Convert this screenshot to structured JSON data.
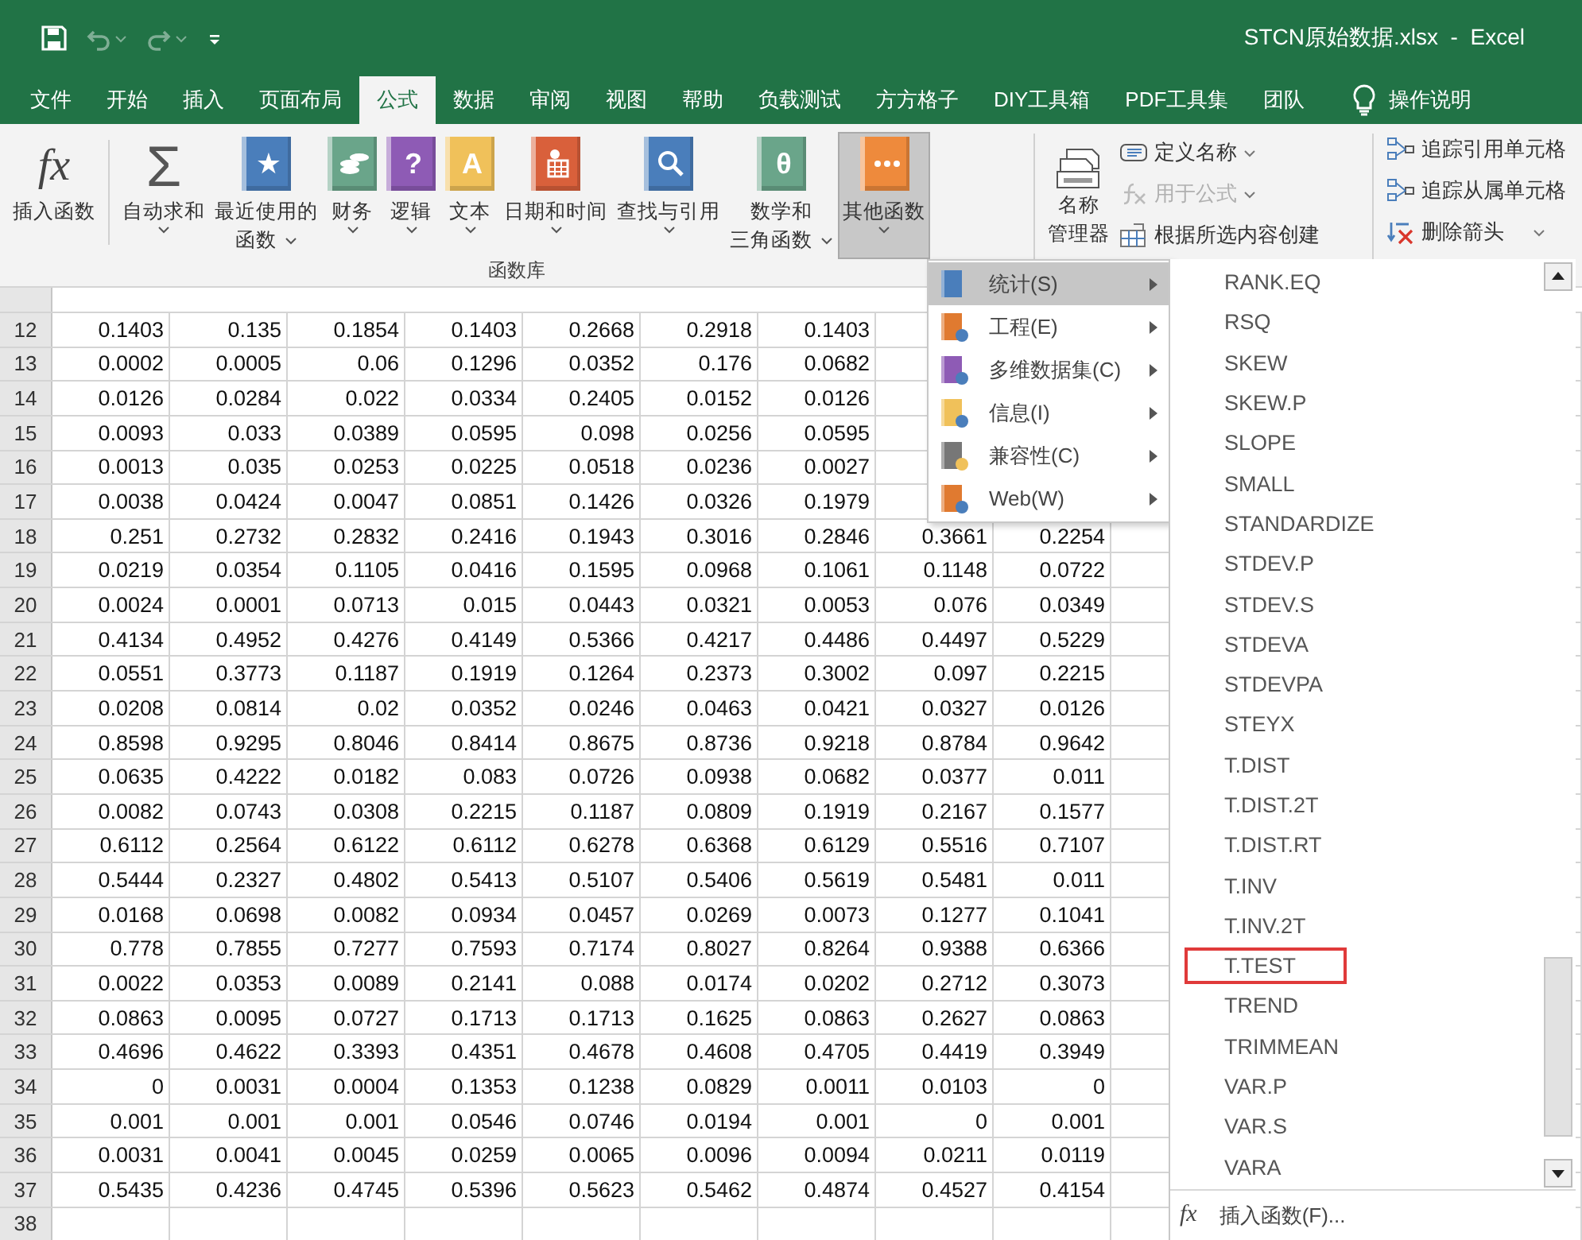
{
  "window": {
    "title": "STCN原始数据.xlsx  -  Excel"
  },
  "tabs": [
    {
      "label": "文件",
      "selected": false
    },
    {
      "label": "开始",
      "selected": false
    },
    {
      "label": "插入",
      "selected": false
    },
    {
      "label": "页面布局",
      "selected": false
    },
    {
      "label": "公式",
      "selected": true
    },
    {
      "label": "数据",
      "selected": false
    },
    {
      "label": "审阅",
      "selected": false
    },
    {
      "label": "视图",
      "selected": false
    },
    {
      "label": "帮助",
      "selected": false
    },
    {
      "label": "负载测试",
      "selected": false
    },
    {
      "label": "方方格子",
      "selected": false
    },
    {
      "label": "DIY工具箱",
      "selected": false
    },
    {
      "label": "PDF工具集",
      "selected": false
    },
    {
      "label": "团队",
      "selected": false
    }
  ],
  "tell_me": {
    "label": "操作说明"
  },
  "function_library": {
    "label": "函数库",
    "buttons": [
      {
        "lines": [
          "插入函数"
        ],
        "glyph": "fx",
        "dropdown": false,
        "pressed": false
      },
      {
        "lines": [
          "自动求和"
        ],
        "glyph": "Σ",
        "dropdown": true,
        "pressed": false
      },
      {
        "lines": [
          "最近使用的",
          "函数"
        ],
        "glyph": "★",
        "dropdown": true,
        "pressed": false
      },
      {
        "lines": [
          "财务"
        ],
        "dropdown": true,
        "pressed": false
      },
      {
        "lines": [
          "逻辑"
        ],
        "glyph": "?",
        "dropdown": true,
        "pressed": false
      },
      {
        "lines": [
          "文本"
        ],
        "glyph": "A",
        "dropdown": true,
        "pressed": false
      },
      {
        "lines": [
          "日期和时间"
        ],
        "dropdown": true,
        "pressed": false
      },
      {
        "lines": [
          "查找与引用"
        ],
        "dropdown": true,
        "pressed": false
      },
      {
        "lines": [
          "数学和",
          "三角函数"
        ],
        "glyph": "θ",
        "dropdown": true,
        "pressed": false
      },
      {
        "lines": [
          "其他函数"
        ],
        "dropdown": true,
        "pressed": true
      }
    ]
  },
  "defined_names": {
    "manager": {
      "lines": [
        "名称",
        "管理器"
      ]
    },
    "commands": [
      {
        "label": "定义名称",
        "dropdown": true,
        "disabled": false
      },
      {
        "label": "用于公式",
        "dropdown": true,
        "disabled": true
      },
      {
        "label": "根据所选内容创建",
        "dropdown": false,
        "disabled": false
      }
    ]
  },
  "auditing": {
    "commands": [
      {
        "label": "追踪引用单元格",
        "dropdown": false
      },
      {
        "label": "追踪从属单元格",
        "dropdown": false
      },
      {
        "label": "删除箭头",
        "dropdown": true
      }
    ]
  },
  "sheet": {
    "rows": [
      {
        "header": "12",
        "cells": [
          "0.1403",
          "0.135",
          "0.1854",
          "0.1403",
          "0.2668",
          "0.2918",
          "0.1403"
        ]
      },
      {
        "header": "13",
        "cells": [
          "0.0002",
          "0.0005",
          "0.06",
          "0.1296",
          "0.0352",
          "0.176",
          "0.0682"
        ]
      },
      {
        "header": "14",
        "cells": [
          "0.0126",
          "0.0284",
          "0.022",
          "0.0334",
          "0.2405",
          "0.0152",
          "0.0126"
        ]
      },
      {
        "header": "15",
        "cells": [
          "0.0093",
          "0.033",
          "0.0389",
          "0.0595",
          "0.098",
          "0.0256",
          "0.0595"
        ]
      },
      {
        "header": "16",
        "cells": [
          "0.0013",
          "0.035",
          "0.0253",
          "0.0225",
          "0.0518",
          "0.0236",
          "0.0027"
        ]
      },
      {
        "header": "17",
        "cells": [
          "0.0038",
          "0.0424",
          "0.0047",
          "0.0851",
          "0.1426",
          "0.0326",
          "0.1979"
        ]
      },
      {
        "header": "18",
        "cells": [
          "0.251",
          "0.2732",
          "0.2832",
          "0.2416",
          "0.1943",
          "0.3016",
          "0.2846",
          "0.3661",
          "0.2254"
        ]
      },
      {
        "header": "19",
        "cells": [
          "0.0219",
          "0.0354",
          "0.1105",
          "0.0416",
          "0.1595",
          "0.0968",
          "0.1061",
          "0.1148",
          "0.0722"
        ]
      },
      {
        "header": "20",
        "cells": [
          "0.0024",
          "0.0001",
          "0.0713",
          "0.015",
          "0.0443",
          "0.0321",
          "0.0053",
          "0.076",
          "0.0349"
        ]
      },
      {
        "header": "21",
        "cells": [
          "0.4134",
          "0.4952",
          "0.4276",
          "0.4149",
          "0.5366",
          "0.4217",
          "0.4486",
          "0.4497",
          "0.5229"
        ]
      },
      {
        "header": "22",
        "cells": [
          "0.0551",
          "0.3773",
          "0.1187",
          "0.1919",
          "0.1264",
          "0.2373",
          "0.3002",
          "0.097",
          "0.2215"
        ]
      },
      {
        "header": "23",
        "cells": [
          "0.0208",
          "0.0814",
          "0.02",
          "0.0352",
          "0.0246",
          "0.0463",
          "0.0421",
          "0.0327",
          "0.0126"
        ]
      },
      {
        "header": "24",
        "cells": [
          "0.8598",
          "0.9295",
          "0.8046",
          "0.8414",
          "0.8675",
          "0.8736",
          "0.9218",
          "0.8784",
          "0.9642"
        ]
      },
      {
        "header": "25",
        "cells": [
          "0.0635",
          "0.4222",
          "0.0182",
          "0.083",
          "0.0726",
          "0.0938",
          "0.0682",
          "0.0377",
          "0.011"
        ]
      },
      {
        "header": "26",
        "cells": [
          "0.0082",
          "0.0743",
          "0.0308",
          "0.2215",
          "0.1187",
          "0.0809",
          "0.1919",
          "0.2167",
          "0.1577"
        ]
      },
      {
        "header": "27",
        "cells": [
          "0.6112",
          "0.2564",
          "0.6122",
          "0.6112",
          "0.6278",
          "0.6368",
          "0.6129",
          "0.5516",
          "0.7107"
        ]
      },
      {
        "header": "28",
        "cells": [
          "0.5444",
          "0.2327",
          "0.4802",
          "0.5413",
          "0.5107",
          "0.5406",
          "0.5619",
          "0.5481",
          "0.011"
        ]
      },
      {
        "header": "29",
        "cells": [
          "0.0168",
          "0.0698",
          "0.0082",
          "0.0934",
          "0.0457",
          "0.0269",
          "0.0073",
          "0.1277",
          "0.1041"
        ]
      },
      {
        "header": "30",
        "cells": [
          "0.778",
          "0.7855",
          "0.7277",
          "0.7593",
          "0.7174",
          "0.8027",
          "0.8264",
          "0.9388",
          "0.6366"
        ]
      },
      {
        "header": "31",
        "cells": [
          "0.0022",
          "0.0353",
          "0.0089",
          "0.2141",
          "0.088",
          "0.0174",
          "0.0202",
          "0.2712",
          "0.3073"
        ]
      },
      {
        "header": "32",
        "cells": [
          "0.0863",
          "0.0095",
          "0.0727",
          "0.1713",
          "0.1713",
          "0.1625",
          "0.0863",
          "0.2627",
          "0.0863"
        ]
      },
      {
        "header": "33",
        "cells": [
          "0.4696",
          "0.4622",
          "0.3393",
          "0.4351",
          "0.4678",
          "0.4608",
          "0.4705",
          "0.4419",
          "0.3949"
        ]
      },
      {
        "header": "34",
        "cells": [
          "0",
          "0.0031",
          "0.0004",
          "0.1353",
          "0.1238",
          "0.0829",
          "0.0011",
          "0.0103",
          "0"
        ]
      },
      {
        "header": "35",
        "cells": [
          "0.001",
          "0.001",
          "0.001",
          "0.0546",
          "0.0746",
          "0.0194",
          "0.001",
          "0",
          "0.001"
        ]
      },
      {
        "header": "36",
        "cells": [
          "0.0031",
          "0.0041",
          "0.0045",
          "0.0259",
          "0.0065",
          "0.0096",
          "0.0094",
          "0.0211",
          "0.0119"
        ]
      },
      {
        "header": "37",
        "cells": [
          "0.5435",
          "0.4236",
          "0.4745",
          "0.5396",
          "0.5623",
          "0.5462",
          "0.4874",
          "0.4527",
          "0.4154"
        ]
      },
      {
        "header": "38",
        "cells": []
      }
    ]
  },
  "menu": {
    "categories": [
      {
        "label": "统计(S)",
        "selected": true
      },
      {
        "label": "工程(E)",
        "selected": false
      },
      {
        "label": "多维数据集(C)",
        "selected": false
      },
      {
        "label": "信息(I)",
        "selected": false
      },
      {
        "label": "兼容性(C)",
        "selected": false
      },
      {
        "label": "Web(W)",
        "selected": false
      }
    ],
    "functions": [
      {
        "label": "RANK.EQ",
        "boxed": false
      },
      {
        "label": "RSQ",
        "boxed": false
      },
      {
        "label": "SKEW",
        "boxed": false
      },
      {
        "label": "SKEW.P",
        "boxed": false
      },
      {
        "label": "SLOPE",
        "boxed": false
      },
      {
        "label": "SMALL",
        "boxed": false
      },
      {
        "label": "STANDARDIZE",
        "boxed": false
      },
      {
        "label": "STDEV.P",
        "boxed": false
      },
      {
        "label": "STDEV.S",
        "boxed": false
      },
      {
        "label": "STDEVA",
        "boxed": false
      },
      {
        "label": "STDEVPA",
        "boxed": false
      },
      {
        "label": "STEYX",
        "boxed": false
      },
      {
        "label": "T.DIST",
        "boxed": false
      },
      {
        "label": "T.DIST.2T",
        "boxed": false
      },
      {
        "label": "T.DIST.RT",
        "boxed": false
      },
      {
        "label": "T.INV",
        "boxed": false
      },
      {
        "label": "T.INV.2T",
        "boxed": false
      },
      {
        "label": "T.TEST",
        "boxed": true
      },
      {
        "label": "TREND",
        "boxed": false
      },
      {
        "label": "TRIMMEAN",
        "boxed": false
      },
      {
        "label": "VAR.P",
        "boxed": false
      },
      {
        "label": "VAR.S",
        "boxed": false
      },
      {
        "label": "VARA",
        "boxed": false
      }
    ],
    "footer": {
      "glyph": "fx",
      "label": "插入函数(F)..."
    }
  }
}
